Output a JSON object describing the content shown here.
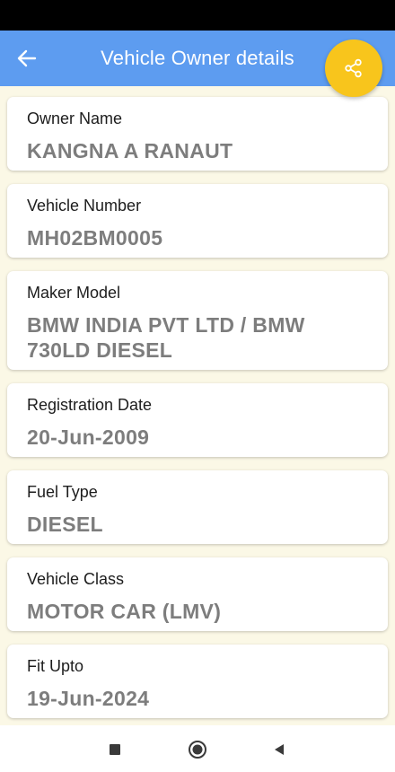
{
  "header": {
    "title": "Vehicle Owner details"
  },
  "icons": {
    "back": "arrow-left-icon",
    "share": "share-icon"
  },
  "colors": {
    "app_bar": "#5d9cf0",
    "fab": "#f8c51c",
    "background": "#fbf8e6",
    "value_text": "#7d7d7d"
  },
  "details": [
    {
      "label": "Owner Name",
      "value": "KANGNA A RANAUT"
    },
    {
      "label": "Vehicle Number",
      "value": "MH02BM0005"
    },
    {
      "label": "Maker Model",
      "value": "BMW INDIA PVT LTD / BMW 730LD DIESEL"
    },
    {
      "label": "Registration Date",
      "value": "20-Jun-2009"
    },
    {
      "label": "Fuel Type",
      "value": "DIESEL"
    },
    {
      "label": "Vehicle Class",
      "value": "MOTOR CAR (LMV)"
    },
    {
      "label": "Fit Upto",
      "value": "19-Jun-2024"
    }
  ]
}
